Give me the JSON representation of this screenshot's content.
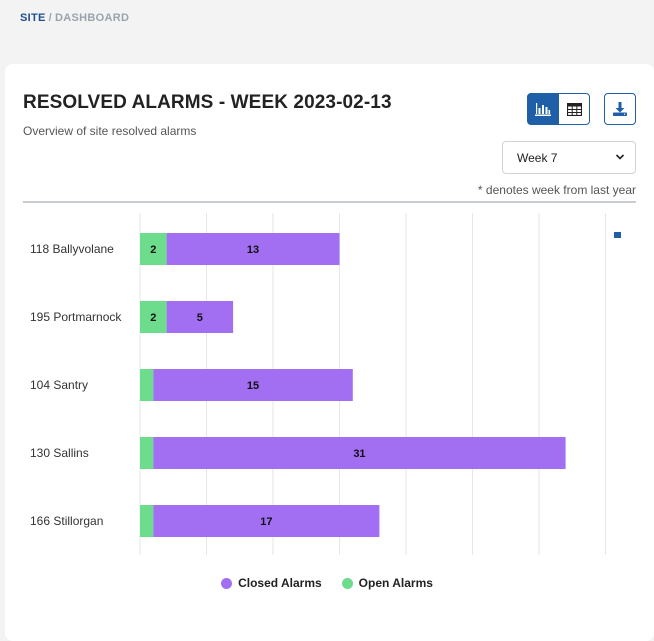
{
  "breadcrumb": {
    "site": "SITE",
    "separator": "/",
    "page": "DASHBOARD"
  },
  "card": {
    "title": "RESOLVED ALARMS - WEEK 2023-02-13",
    "subtitle": "Overview of site resolved alarms",
    "week_select": {
      "value": "Week 7"
    },
    "note": "* denotes week from last year"
  },
  "toolbar": {
    "chart_icon": "bar-chart-icon",
    "table_icon": "table-icon",
    "download_icon": "download-icon"
  },
  "colors": {
    "closed": "#a26ef2",
    "open": "#6ddc8c",
    "accent": "#1f5fa8"
  },
  "chart_data": {
    "type": "bar",
    "orientation": "horizontal",
    "stacked": true,
    "categories": [
      "118 Ballyvolane",
      "195 Portmarnock",
      "104 Santry",
      "130 Sallins",
      "166 Stillorgan"
    ],
    "series": [
      {
        "name": "Open Alarms",
        "values": [
          2,
          2,
          1,
          1,
          1
        ],
        "value_labels": [
          "2",
          "2",
          "",
          "",
          ""
        ]
      },
      {
        "name": "Closed Alarms",
        "values": [
          13,
          5,
          15,
          31,
          17
        ],
        "value_labels": [
          "13",
          "5",
          "15",
          "31",
          "17"
        ]
      }
    ],
    "xlim": [
      0,
      35
    ],
    "grid": true,
    "legend": {
      "placement": "bottom",
      "entries": [
        "Closed Alarms",
        "Open Alarms"
      ]
    }
  }
}
